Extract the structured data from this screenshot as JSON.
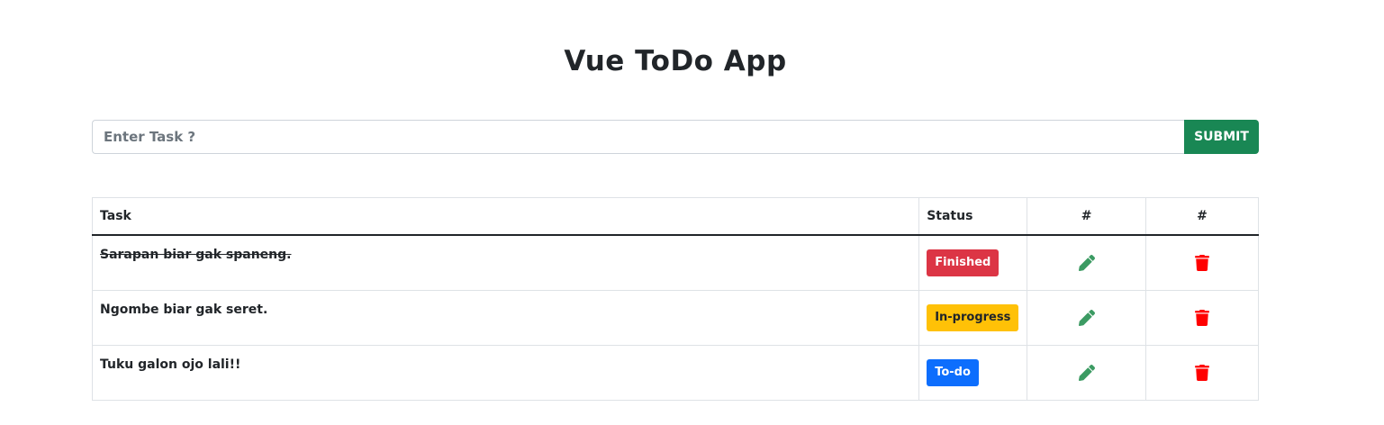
{
  "header": {
    "title": "Vue ToDo App"
  },
  "form": {
    "placeholder": "Enter Task ?",
    "value": "",
    "submit_label": "SUBMIT",
    "submit_color": "#198754"
  },
  "table": {
    "headers": [
      "Task",
      "Status",
      "#",
      "#"
    ],
    "rows": [
      {
        "task": "Sarapan biar gak spaneng.",
        "completed": true,
        "status": "Finished",
        "status_color": "#dc3545",
        "status_text_color": "#ffffff",
        "edit_icon": "pencil-icon",
        "delete_icon": "trash-icon"
      },
      {
        "task": "Ngombe biar gak seret.",
        "completed": false,
        "status": "In-progress",
        "status_color": "#ffc107",
        "status_text_color": "#212529",
        "edit_icon": "pencil-icon",
        "delete_icon": "trash-icon"
      },
      {
        "task": "Tuku galon ojo lali!!",
        "completed": false,
        "status": "To-do",
        "status_color": "#0d6efd",
        "status_text_color": "#ffffff",
        "edit_icon": "pencil-icon",
        "delete_icon": "trash-icon"
      }
    ]
  },
  "colors": {
    "edit_icon": "#3c9b63",
    "delete_icon": "#ff0000",
    "text": "#212529"
  }
}
